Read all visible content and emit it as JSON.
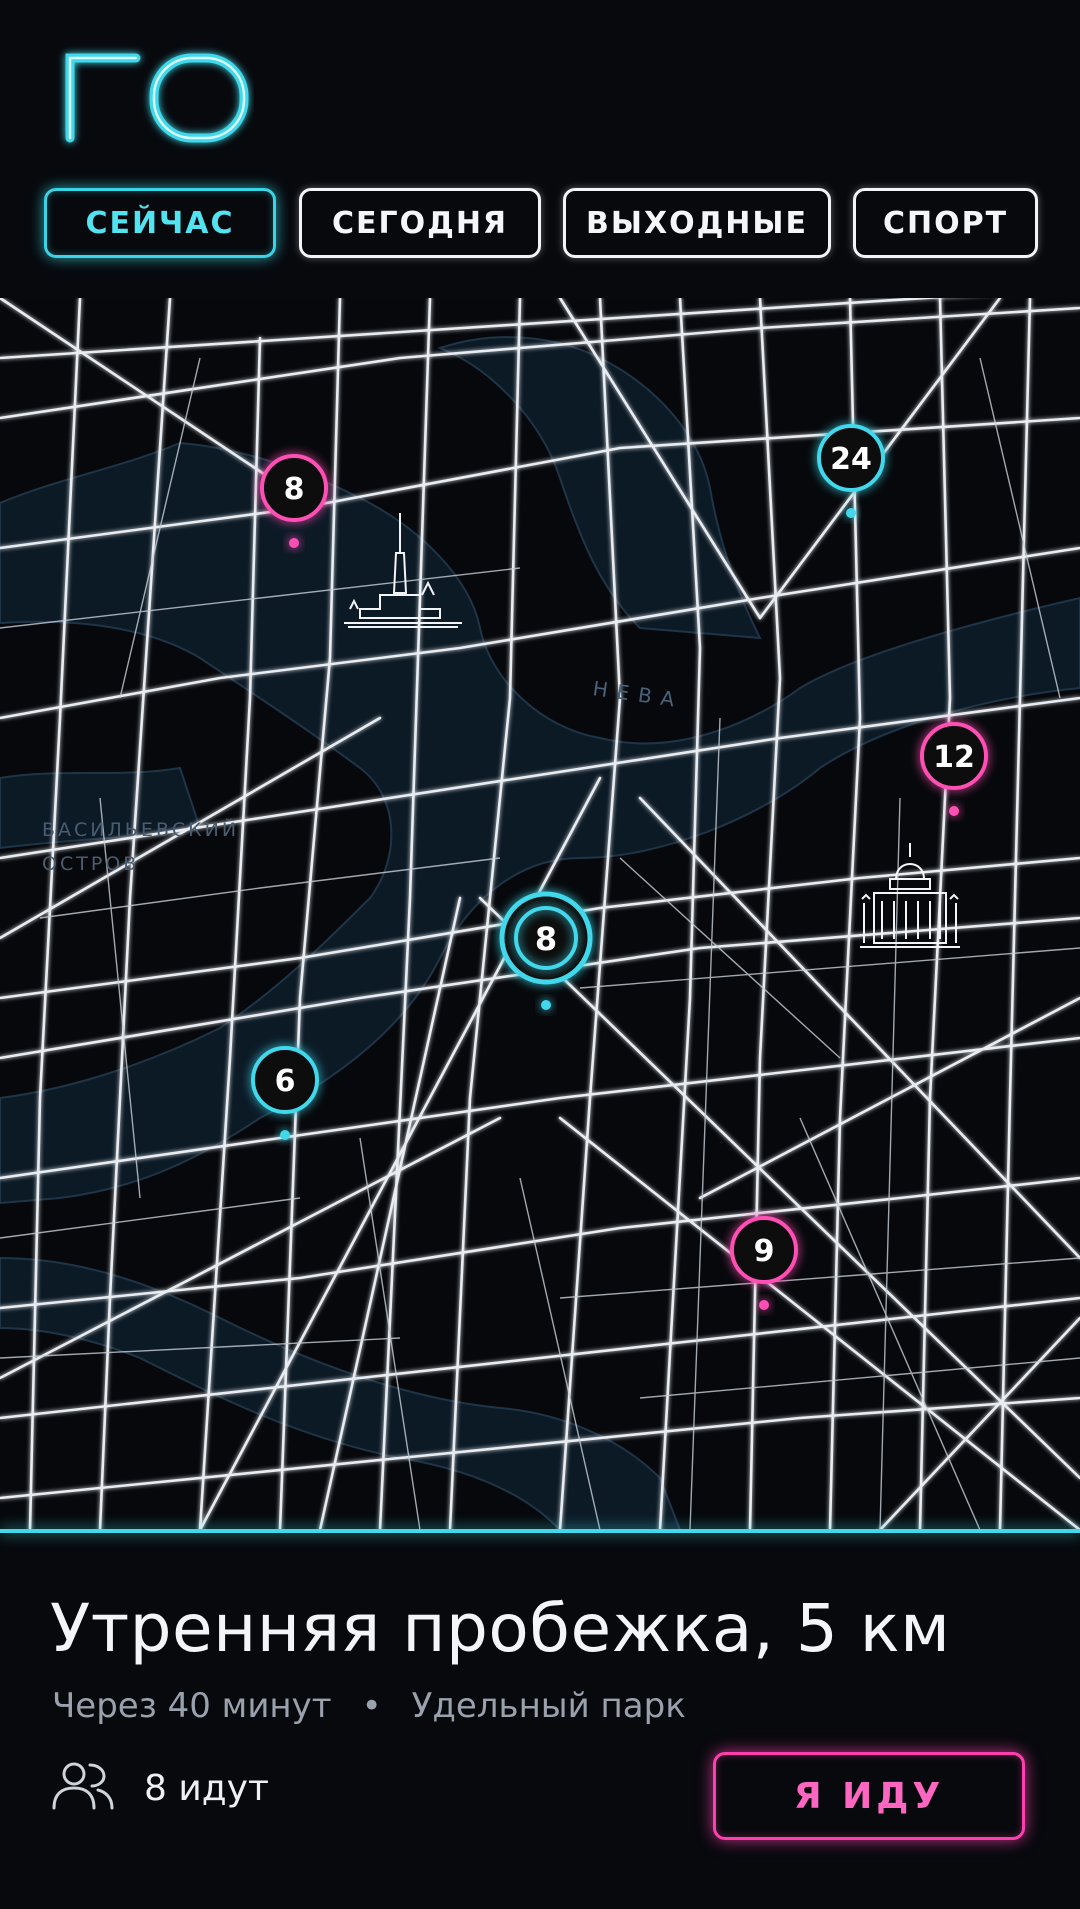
{
  "app": {
    "logo_text": "ГО"
  },
  "tabs": [
    {
      "label": "СЕЙЧАС",
      "active": true
    },
    {
      "label": "СЕГОДНЯ",
      "active": false
    },
    {
      "label": "ВЫХОДНЫЕ",
      "active": false
    },
    {
      "label": "СПОРТ",
      "active": false
    }
  ],
  "map": {
    "labels": {
      "river": "НЕВА",
      "island_line1": "ВАСИЛЬЕВСКИЙ",
      "island_line2": "ОСТРОВ"
    },
    "pins": [
      {
        "count": "8",
        "color": "#ff4fb4"
      },
      {
        "count": "24",
        "color": "#3fd8ea"
      },
      {
        "count": "12",
        "color": "#ff4fb4"
      },
      {
        "count": "8",
        "color": "#3fd8ea",
        "selected": true
      },
      {
        "count": "6",
        "color": "#3fd8ea"
      },
      {
        "count": "9",
        "color": "#ff4fb4"
      }
    ],
    "landmark_icons": [
      "fortress-spire-icon",
      "cathedral-dome-icon"
    ]
  },
  "event": {
    "title": "Утренняя пробежка, 5 км",
    "time": "Через 40 минут",
    "separator": "•",
    "place": "Удельный парк",
    "attendees": "8 идут",
    "cta_label": "Я ИДУ"
  },
  "colors": {
    "background": "#07090d",
    "accent_cyan": "#3fd8ea",
    "accent_pink": "#ff4fb4",
    "water": "#0c1a26"
  }
}
